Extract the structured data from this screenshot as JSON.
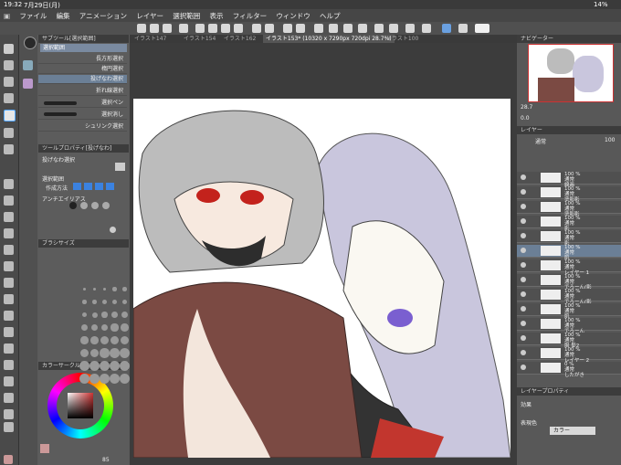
{
  "status": {
    "time": "19:32",
    "date": "7月29日(月)",
    "battery": "14%"
  },
  "menu": [
    "ファイル",
    "編集",
    "アニメーション",
    "レイヤー",
    "選択範囲",
    "表示",
    "フィルター",
    "ウィンドウ",
    "ヘルプ"
  ],
  "tabs": [
    "イラスト147",
    "イラスト154",
    "イラスト162",
    "イラスト153* (10320 x 7290px 720dpi 28.7%)",
    "イラスト100"
  ],
  "left_panel": {
    "subtool_header": "サブツール[選択範囲]",
    "subtool_group": "選択範囲",
    "subtools": [
      "長方形選択",
      "楕円選択",
      "投げなわ選択",
      "折れ線選択",
      "選択ペン",
      "選択消し",
      "シュリンク選択"
    ],
    "tool_property_header": "ツールプロパティ[投げなわ]",
    "tool_property_name": "投げなわ選択",
    "prop_select_range": "選択範囲",
    "prop_creation_method": "作成方法",
    "prop_antialias": "アンチエイリアス",
    "brush_size_header": "ブラシサイズ",
    "color_circle_header": "カラーサークル",
    "color_value": "85"
  },
  "right_panel": {
    "navigator_header": "ナビゲーター",
    "zoom": "28.7",
    "rotate": "0.0",
    "layer_header": "レイヤー",
    "blend_mode": "通常",
    "opacity": "100",
    "layers": [
      {
        "pct": "100 %",
        "mode": "通常",
        "name": "線画"
      },
      {
        "pct": "100 %",
        "mode": "通常",
        "name": "塗影影"
      },
      {
        "pct": "100 %",
        "mode": "通常",
        "name": "塗影影"
      },
      {
        "pct": "100 %",
        "mode": "通常",
        "name": "影"
      },
      {
        "pct": "100 %",
        "mode": "通常",
        "name": "影"
      },
      {
        "pct": "100 %",
        "mode": "通常",
        "name": "肌"
      },
      {
        "pct": "100 %",
        "mode": "通常",
        "name": "レイヤー 1"
      },
      {
        "pct": "100 %",
        "mode": "通常",
        "name": "でろーん(影"
      },
      {
        "pct": "100 %",
        "mode": "通常",
        "name": "でろーん(影"
      },
      {
        "pct": "100 %",
        "mode": "通常",
        "name": "肌"
      },
      {
        "pct": "100 %",
        "mode": "通常",
        "name": "でろーん"
      },
      {
        "pct": "100 %",
        "mode": "通常",
        "name": "服 髪2"
      },
      {
        "pct": "100 %",
        "mode": "通常",
        "name": "レイヤー 2"
      },
      {
        "pct": "0 %",
        "mode": "通常",
        "name": "したがき"
      }
    ],
    "layer_property_header": "レイヤープロパティ",
    "effect_label": "効果",
    "expression_color_label": "表現色",
    "expression_color_value": "カラー"
  }
}
